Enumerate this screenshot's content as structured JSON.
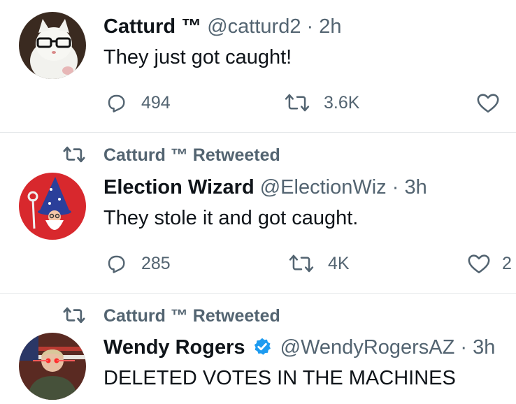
{
  "tweets": [
    {
      "retweeted_by": "",
      "name": "Catturd ™",
      "handle": "@catturd2",
      "separator": "·",
      "time": "2h",
      "text": "They just got caught!",
      "replies": "494",
      "retweets": "3.6K",
      "likes": ""
    },
    {
      "retweeted_by": "Catturd ™ Retweeted",
      "name": "Election Wizard",
      "handle": "@ElectionWiz",
      "separator": "·",
      "time": "3h",
      "text": "They stole it and got caught.",
      "replies": "285",
      "retweets": "4K",
      "likes": "2"
    },
    {
      "retweeted_by": "Catturd ™ Retweeted",
      "name": "Wendy Rogers",
      "verified": true,
      "handle": "@WendyRogersAZ",
      "separator": "·",
      "time": "3h",
      "text": "DELETED VOTES IN THE MACHINES"
    }
  ],
  "icons": {
    "reply": "reply-icon",
    "retweet": "retweet-icon",
    "like": "heart-icon",
    "verified": "verified-badge-icon"
  },
  "colors": {
    "text": "#0f1419",
    "secondary": "#536471",
    "verified": "#1d9bf0",
    "divider": "#e6e9eb"
  }
}
